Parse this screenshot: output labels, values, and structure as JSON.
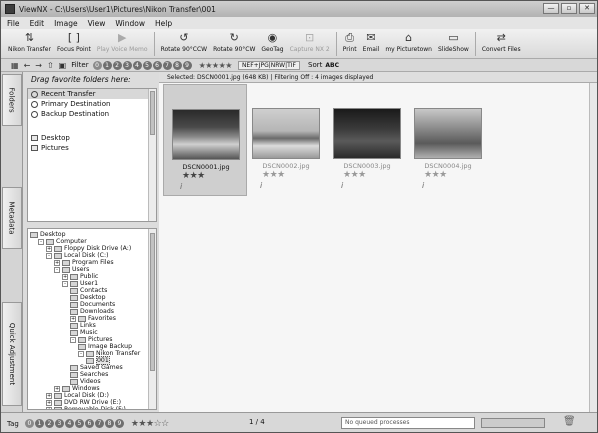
{
  "window": {
    "title": "ViewNX - C:\\Users\\User1\\Pictures\\Nikon Transfer\\001",
    "controls": [
      "—",
      "▫",
      "✕"
    ]
  },
  "menu": [
    "File",
    "Edit",
    "Image",
    "View",
    "Window",
    "Help"
  ],
  "toolbar": [
    {
      "label": "Nikon Transfer",
      "icon": "nikon-transfer-icon",
      "glyph": "⇅",
      "disabled": false
    },
    {
      "label": "Focus Point",
      "icon": "focus-point-icon",
      "glyph": "[ ]",
      "disabled": false
    },
    {
      "label": "Play Voice Memo",
      "icon": "voice-memo-icon",
      "glyph": "▶",
      "disabled": true
    },
    {
      "label": "Rotate 90°CCW",
      "icon": "rotate-ccw-icon",
      "glyph": "↺",
      "disabled": false
    },
    {
      "label": "Rotate 90°CW",
      "icon": "rotate-cw-icon",
      "glyph": "↻",
      "disabled": false
    },
    {
      "label": "GeoTag",
      "icon": "geotag-icon",
      "glyph": "◉",
      "disabled": false
    },
    {
      "label": "Capture NX 2",
      "icon": "capture-nx-icon",
      "glyph": "⊡",
      "disabled": true
    },
    {
      "label": "Print",
      "icon": "print-icon",
      "glyph": "⎙",
      "disabled": false
    },
    {
      "label": "Email",
      "icon": "email-icon",
      "glyph": "✉",
      "disabled": false
    },
    {
      "label": "my Picturetown",
      "icon": "picturetown-icon",
      "glyph": "⌂",
      "disabled": false
    },
    {
      "label": "SlideShow",
      "icon": "slideshow-icon",
      "glyph": "▭",
      "disabled": false
    },
    {
      "label": "Convert Files",
      "icon": "convert-files-icon",
      "glyph": "⇄",
      "disabled": false
    }
  ],
  "filterbar": {
    "label": "Filter",
    "numbers": [
      "0",
      "1",
      "2",
      "3",
      "4",
      "5",
      "6",
      "7",
      "8",
      "9"
    ],
    "stars": "★★★★★",
    "format": "NEF+JPG|NRW|TIF",
    "sort_label": "Sort",
    "sort_value": "ABC"
  },
  "lefttabs": [
    "Folders",
    "Metadata",
    "Quick Adjustment"
  ],
  "favorites": {
    "header": "Drag favorite folders here:",
    "items": [
      {
        "label": "Recent Transfer",
        "selected": true
      },
      {
        "label": "Primary Destination",
        "selected": false
      },
      {
        "label": "Backup Destination",
        "selected": false
      },
      {
        "label": "Desktop",
        "selected": false
      },
      {
        "label": "Pictures",
        "selected": false
      }
    ]
  },
  "tree": [
    {
      "label": "Desktop",
      "level": 0,
      "expander": ""
    },
    {
      "label": "Computer",
      "level": 1,
      "expander": "-"
    },
    {
      "label": "Floppy Disk Drive (A:)",
      "level": 2,
      "expander": "+"
    },
    {
      "label": "Local Disk (C:)",
      "level": 2,
      "expander": "-"
    },
    {
      "label": "Program Files",
      "level": 3,
      "expander": "+"
    },
    {
      "label": "Users",
      "level": 3,
      "expander": "-"
    },
    {
      "label": "Public",
      "level": 4,
      "expander": "+"
    },
    {
      "label": "User1",
      "level": 4,
      "expander": "-"
    },
    {
      "label": "Contacts",
      "level": 5,
      "expander": ""
    },
    {
      "label": "Desktop",
      "level": 5,
      "expander": ""
    },
    {
      "label": "Documents",
      "level": 5,
      "expander": ""
    },
    {
      "label": "Downloads",
      "level": 5,
      "expander": ""
    },
    {
      "label": "Favorites",
      "level": 5,
      "expander": "+"
    },
    {
      "label": "Links",
      "level": 5,
      "expander": ""
    },
    {
      "label": "Music",
      "level": 5,
      "expander": ""
    },
    {
      "label": "Pictures",
      "level": 5,
      "expander": "-"
    },
    {
      "label": "Image Backup",
      "level": 6,
      "expander": ""
    },
    {
      "label": "Nikon Transfer",
      "level": 6,
      "expander": "-"
    },
    {
      "label": "001",
      "level": 7,
      "expander": "",
      "selected": true
    },
    {
      "label": "Saved Games",
      "level": 5,
      "expander": ""
    },
    {
      "label": "Searches",
      "level": 5,
      "expander": ""
    },
    {
      "label": "Videos",
      "level": 5,
      "expander": ""
    },
    {
      "label": "Windows",
      "level": 3,
      "expander": "+"
    },
    {
      "label": "Local Disk (D:)",
      "level": 2,
      "expander": "+"
    },
    {
      "label": "DVD RW Drive (E:)",
      "level": 2,
      "expander": "+"
    },
    {
      "label": "Removable Disk (F:)",
      "level": 2,
      "expander": "+"
    }
  ],
  "status": "Selected: DSCN0001.jpg (648 KB) | Filtering Off : 4 images displayed",
  "thumbnails": [
    {
      "filename": "DSCN0001.jpg",
      "stars": "★★★",
      "info": "i",
      "selected": true
    },
    {
      "filename": "DSCN0002.jpg",
      "stars": "★★★",
      "info": "i",
      "selected": false
    },
    {
      "filename": "DSCN0003.jpg",
      "stars": "★★★",
      "info": "i",
      "selected": false
    },
    {
      "filename": "DSCN0004.jpg",
      "stars": "★★★",
      "info": "i",
      "selected": false
    }
  ],
  "bottombar": {
    "tag_label": "Tag",
    "numbers": [
      "0",
      "1",
      "2",
      "3",
      "4",
      "5",
      "6",
      "7",
      "8",
      "9"
    ],
    "rating": "★★★☆☆",
    "page": "1 / 4",
    "queue": "No queued processes"
  }
}
